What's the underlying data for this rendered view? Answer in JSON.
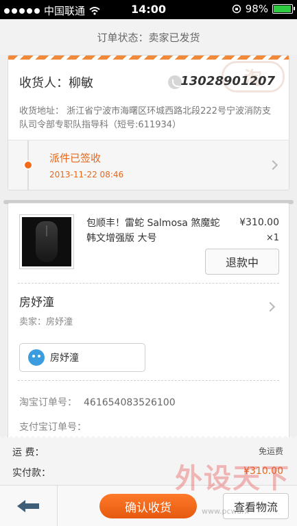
{
  "status_bar": {
    "carrier": "中国联通",
    "time": "14:00",
    "battery_pct": "98%",
    "battery_level": 0.98,
    "icons": [
      "signal-dots-icon",
      "wifi-icon",
      "rotation-lock-icon",
      "battery-icon"
    ]
  },
  "order_status": "订单状态：卖家已发货",
  "receiver": {
    "label": "收货人：柳敏",
    "phone": "13028901207",
    "address": "收货地址：  浙江省宁波市海曙区环城西路北段222号宁波消防支队司令部专职队指导科（短号:611934）"
  },
  "logistics": {
    "status": "派件已签收",
    "time": "2013-11-22 08:46"
  },
  "product": {
    "title": "包顺丰！雷蛇 Salmosa 煞魔蛇 韩文增强版 大号",
    "price": "¥310.00",
    "qty": "×1",
    "refund_label": "退款中"
  },
  "shop": {
    "name": "房妤潼",
    "seller": "卖家：房妤潼",
    "chat_name": "房妤潼"
  },
  "order_info": {
    "taobao_label": "淘宝订单号：",
    "taobao_no": "461654083526100",
    "alipay_label": "支付宝订单号："
  },
  "summary": {
    "shipping_label": "运    费：",
    "shipping_value": "免运费",
    "paid_label": "实付款：",
    "paid_value": "¥310.00"
  },
  "bottom": {
    "confirm_label": "确认收货",
    "logistics_label": "查看物流"
  },
  "watermark": {
    "text": "外设天下",
    "url": "www.pcwarx"
  },
  "colors": {
    "accent": "#e5671b",
    "button": "#f26b1d"
  }
}
